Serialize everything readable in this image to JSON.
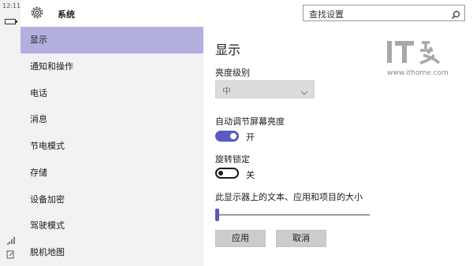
{
  "status": {
    "time": "12:11"
  },
  "header": {
    "title": "系统",
    "search_placeholder": "查找设置"
  },
  "nav": {
    "items": [
      {
        "label": "显示"
      },
      {
        "label": "通知和操作"
      },
      {
        "label": "电话"
      },
      {
        "label": "消息"
      },
      {
        "label": "节电模式"
      },
      {
        "label": "存储"
      },
      {
        "label": "设备加密"
      },
      {
        "label": "驾驶模式"
      },
      {
        "label": "脱机地图"
      }
    ],
    "active_index": 0
  },
  "content": {
    "title": "显示",
    "brightness_label": "亮度级别",
    "brightness_value": "中",
    "auto_brightness_label": "自动调节屏幕亮度",
    "auto_brightness_state": "开",
    "auto_brightness_on": true,
    "rotation_lock_label": "旋转锁定",
    "rotation_lock_state": "关",
    "rotation_lock_on": false,
    "text_size_label": "此显示器上的文本、应用和项目的大小",
    "text_size_fraction": 0.0,
    "apply_label": "应用",
    "cancel_label": "取消"
  },
  "watermark": {
    "logo": "IT之家",
    "url": "www.ithome.com"
  },
  "colors": {
    "accent": "#5c59c4",
    "nav_selected": "#b3b0e0",
    "nav_bg": "#f2f2f2"
  }
}
